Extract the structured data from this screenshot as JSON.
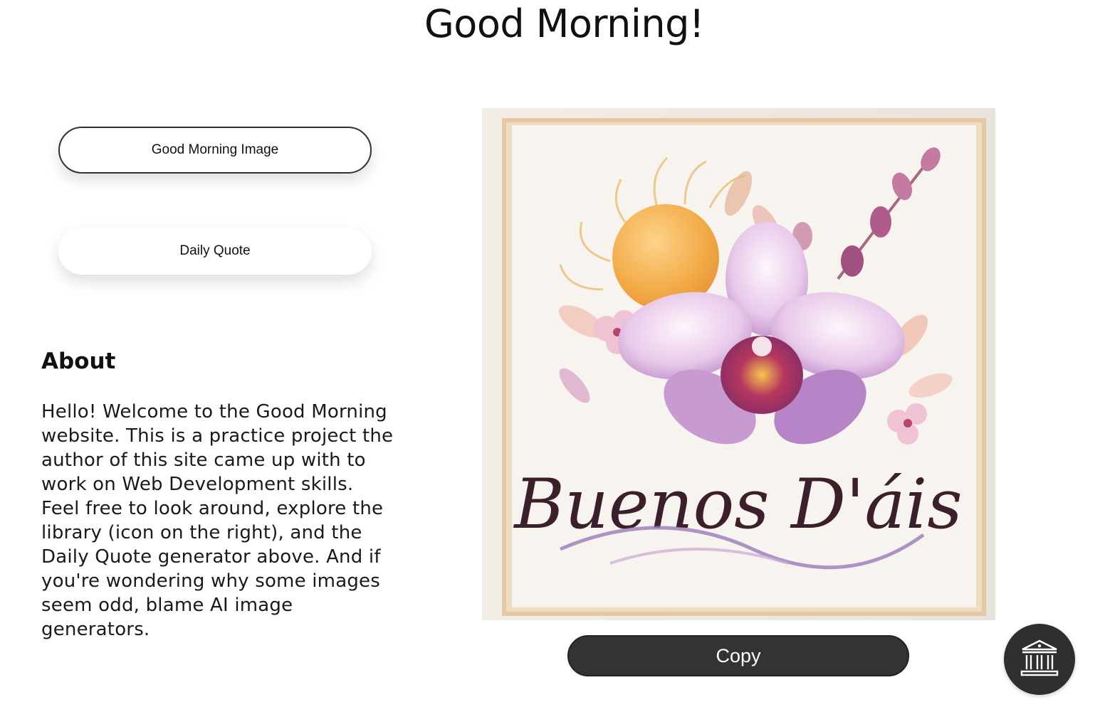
{
  "header": {
    "title": "Good Morning!"
  },
  "nav": {
    "image_button_label": "Good Morning Image",
    "quote_button_label": "Daily Quote"
  },
  "about": {
    "heading": "About",
    "text": "Hello! Welcome to the Good Morning website. This is a practice project the author of this site came up with to work on Web Development skills. Feel free to look around, explore the library (icon on the right), and the Daily Quote generator above. And if you're wondering why some images seem odd, blame AI image generators."
  },
  "image": {
    "caption_text": "Buenos D'áis"
  },
  "actions": {
    "copy_label": "Copy"
  },
  "icons": {
    "library": "bank-building-icon"
  },
  "colors": {
    "button_dark": "#333333",
    "outline": "#333333"
  }
}
